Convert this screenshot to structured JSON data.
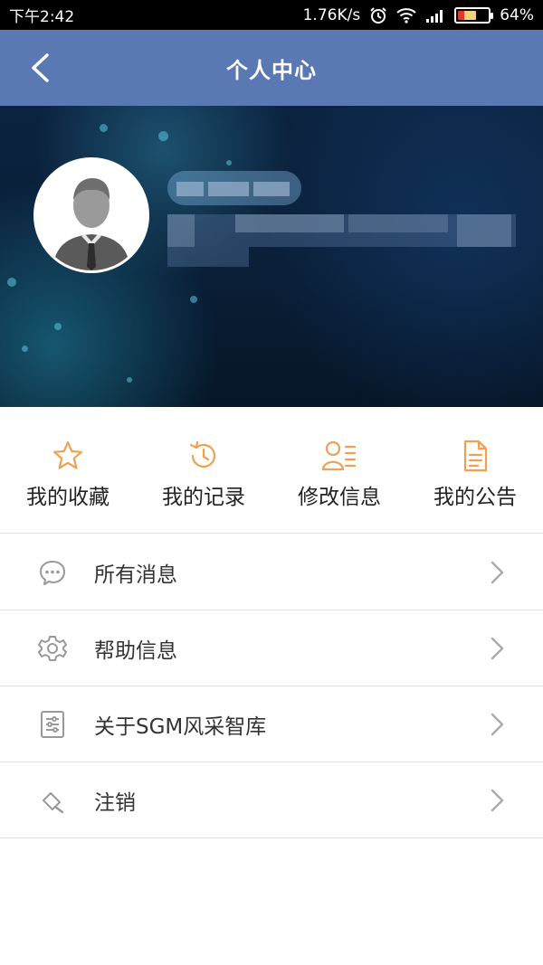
{
  "status_bar": {
    "time": "下午2:42",
    "speed": "1.76K/s",
    "battery": "64%",
    "battery_level": 0.64,
    "icons": [
      "alarm-icon",
      "wifi-icon",
      "signal-icon",
      "battery-icon"
    ]
  },
  "header": {
    "title": "个人中心",
    "background": "#5a78b3"
  },
  "profile": {
    "avatar_icon": "user-avatar-icon"
  },
  "quick_actions": [
    {
      "label": "我的收藏",
      "icon": "star-icon"
    },
    {
      "label": "我的记录",
      "icon": "history-icon"
    },
    {
      "label": "修改信息",
      "icon": "edit-profile-icon"
    },
    {
      "label": "我的公告",
      "icon": "document-icon"
    }
  ],
  "menu": [
    {
      "label": "所有消息",
      "icon": "chat-bubble-icon"
    },
    {
      "label": "帮助信息",
      "icon": "gear-icon"
    },
    {
      "label": "关于SGM风采智库",
      "icon": "settings-panel-icon"
    },
    {
      "label": "注销",
      "icon": "logout-icon"
    }
  ],
  "colors": {
    "accent": "#f0a055",
    "icon_gray": "#999999",
    "divider": "#e3e3e3"
  }
}
